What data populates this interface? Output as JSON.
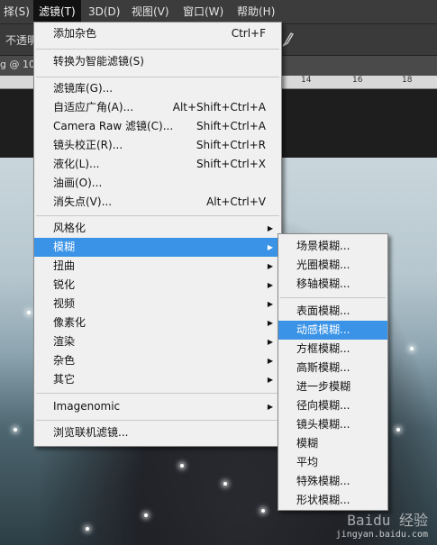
{
  "menubar": {
    "items": [
      "择(S)",
      "滤镜(T)",
      "3D(D)",
      "视图(V)",
      "窗口(W)",
      "帮助(H)"
    ]
  },
  "options": {
    "opacity_label": "不透明"
  },
  "doc_tab": {
    "label": "g @ 10"
  },
  "ruler": {
    "ticks": [
      "14",
      "16",
      "18"
    ]
  },
  "filter_menu": {
    "last_filter": {
      "label": "添加杂色",
      "shortcut": "Ctrl+F"
    },
    "convert_smart": "转换为智能滤镜(S)",
    "items_a": [
      {
        "label": "滤镜库(G)...",
        "shortcut": ""
      },
      {
        "label": "自适应广角(A)...",
        "shortcut": "Alt+Shift+Ctrl+A"
      },
      {
        "label": "Camera Raw 滤镜(C)...",
        "shortcut": "Shift+Ctrl+A"
      },
      {
        "label": "镜头校正(R)...",
        "shortcut": "Shift+Ctrl+R"
      },
      {
        "label": "液化(L)...",
        "shortcut": "Shift+Ctrl+X"
      },
      {
        "label": "油画(O)...",
        "shortcut": ""
      },
      {
        "label": "消失点(V)...",
        "shortcut": "Alt+Ctrl+V"
      }
    ],
    "groups": [
      "风格化",
      "模糊",
      "扭曲",
      "锐化",
      "视频",
      "像素化",
      "渲染",
      "杂色",
      "其它"
    ],
    "plugin": "Imagenomic",
    "browse": "浏览联机滤镜..."
  },
  "blur_submenu": {
    "items_a": [
      "场景模糊...",
      "光圈模糊...",
      "移轴模糊..."
    ],
    "items_b": [
      "表面模糊...",
      "动感模糊...",
      "方框模糊...",
      "高斯模糊...",
      "进一步模糊",
      "径向模糊...",
      "镜头模糊...",
      "模糊",
      "平均",
      "特殊模糊...",
      "形状模糊..."
    ]
  },
  "watermark": {
    "brand": "Baidu 经验",
    "url": "jingyan.baidu.com"
  },
  "colors": {
    "highlight": "#3a93e6",
    "menu_bg": "#f0f0f0",
    "menubar_bg": "#3c3c3c"
  }
}
